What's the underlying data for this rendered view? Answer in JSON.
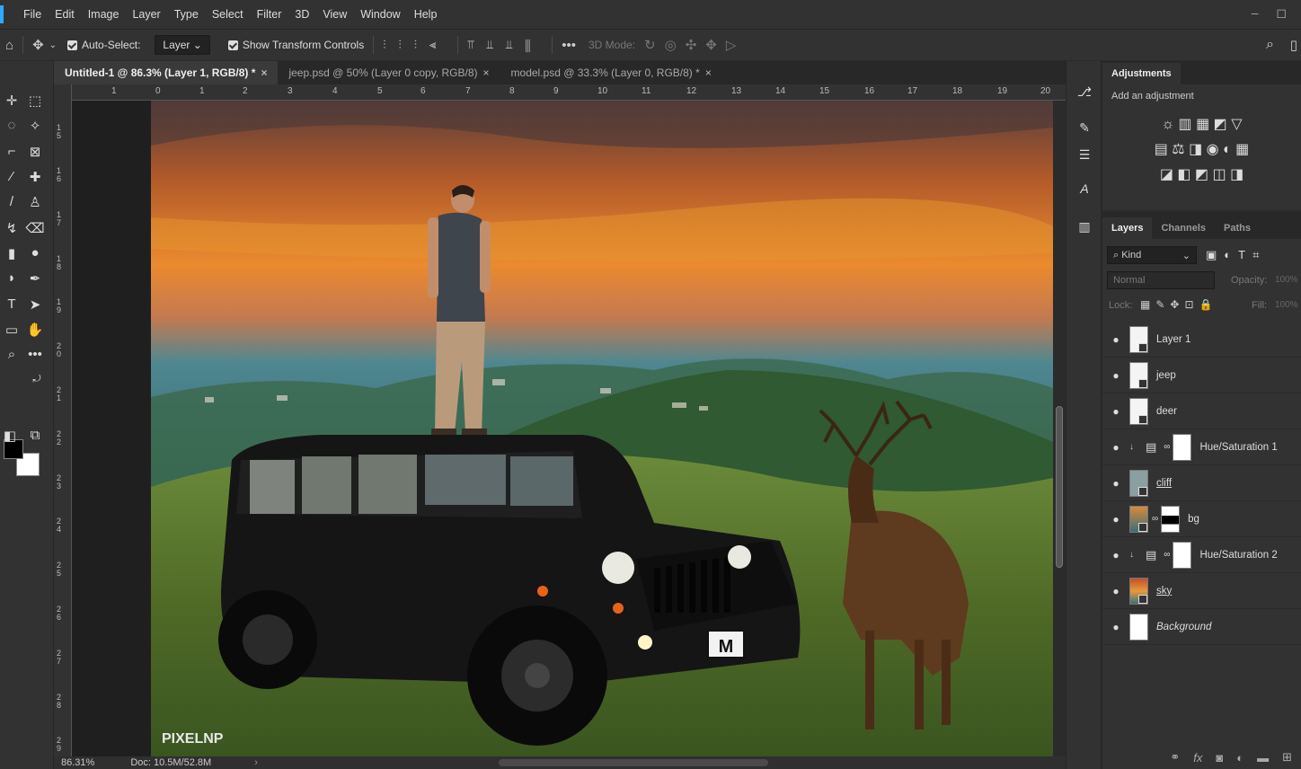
{
  "menu": [
    "File",
    "Edit",
    "Image",
    "Layer",
    "Type",
    "Select",
    "Filter",
    "3D",
    "View",
    "Window",
    "Help"
  ],
  "options": {
    "auto_select_label": "Auto-Select:",
    "auto_select_value": "Layer",
    "show_transform_label": "Show Transform Controls",
    "mode_3d_label": "3D Mode:"
  },
  "tabs": [
    {
      "label": "Untitled-1 @ 86.3% (Layer 1, RGB/8) *"
    },
    {
      "label": "jeep.psd @ 50% (Layer 0 copy, RGB/8)"
    },
    {
      "label": "model.psd @ 33.3% (Layer 0, RGB/8) *"
    }
  ],
  "tab_close": "×",
  "ruler_top": [
    "1",
    "0",
    "1",
    "2",
    "3",
    "4",
    "5",
    "6",
    "7",
    "8",
    "9",
    "10",
    "11",
    "12",
    "13",
    "14",
    "15",
    "16",
    "17",
    "18",
    "19",
    "20"
  ],
  "ruler_left": [
    "1\n5",
    "1\n6",
    "1\n7",
    "1\n8",
    "1\n9",
    "2\n0",
    "2\n1",
    "2\n2",
    "2\n3",
    "2\n4",
    "2\n5",
    "2\n6",
    "2\n7",
    "2\n8",
    "2\n9"
  ],
  "canvas": {
    "watermark": "PIXELNP",
    "plate": "M"
  },
  "status": {
    "zoom": "86.31%",
    "doc": "Doc: 10.5M/52.8M"
  },
  "adjustments": {
    "tab": "Adjustments",
    "hint": "Add an adjustment",
    "row1": "☼ ▥ ▦ ◩ ▽",
    "row2": "▤ ⚖ ◨ ◉ ◐ ▦",
    "row3": "◪ ◧ ◩ ◫ ◨"
  },
  "layers_panel": {
    "tabs": [
      "Layers",
      "Channels",
      "Paths"
    ],
    "kind": "Kind",
    "blend": "Normal",
    "opacity_label": "Opacity:",
    "opacity_value": "100%",
    "lock_label": "Lock:",
    "fill_label": "Fill:",
    "fill_value": "100%",
    "layers": [
      {
        "name": "Layer 1"
      },
      {
        "name": "jeep"
      },
      {
        "name": "deer"
      },
      {
        "name": "Hue/Saturation 1"
      },
      {
        "name": "cliff"
      },
      {
        "name": "bg"
      },
      {
        "name": "Hue/Saturation 2"
      },
      {
        "name": "sky"
      },
      {
        "name": "Background"
      }
    ]
  },
  "colors": {
    "accent": "#31a8ff",
    "panel": "#323232",
    "sky_top": "#6a4a3a",
    "sky_glow": "#e8872c",
    "valley": "#3f7d88",
    "grass": "#4a6a28"
  }
}
